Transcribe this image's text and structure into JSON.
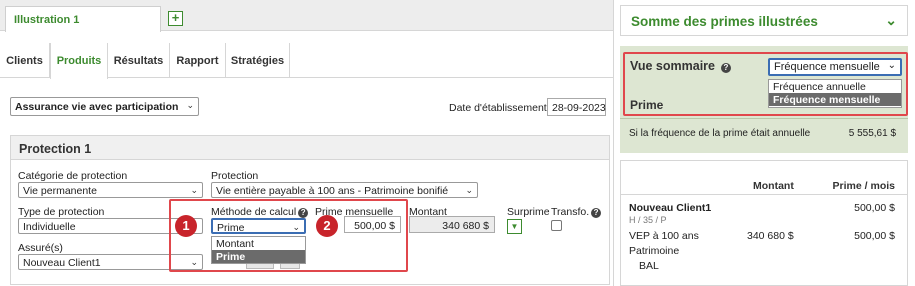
{
  "app": {
    "tab_title": "Illustration 1",
    "add_tab_label": "+"
  },
  "nav": {
    "tabs": [
      {
        "label": "Clients"
      },
      {
        "label": "Produits"
      },
      {
        "label": "Résultats"
      },
      {
        "label": "Rapport"
      },
      {
        "label": "Stratégies"
      }
    ],
    "active": "Produits"
  },
  "product": {
    "selected": "Assurance vie avec participation",
    "date_label": "Date d'établissement",
    "date_value": "28-09-2023"
  },
  "protection": {
    "title": "Protection 1",
    "category_label": "Catégorie de protection",
    "category_value": "Vie permanente",
    "protection_label": "Protection",
    "protection_value": "Vie entière payable à 100 ans - Patrimoine bonifié",
    "type_label": "Type de protection",
    "type_value": "Individuelle",
    "method_label": "Méthode de calcul",
    "method_value": "Prime",
    "method_options": [
      "Montant",
      "Prime"
    ],
    "premium_label": "Prime mensuelle",
    "premium_value": "500,00 $",
    "amount_label": "Montant",
    "amount_value": "340 680 $",
    "surprime_label": "Surprime",
    "transfo_label": "Transfo.",
    "insured_label": "Assuré(s)",
    "insured_value": "Nouveau Client1"
  },
  "badges": [
    "1",
    "2"
  ],
  "summary": {
    "title": "Somme des primes illustrées",
    "vue_title": "Vue sommaire",
    "frequency_selected": "Fréquence mensuelle",
    "frequency_options": [
      "Fréquence annuelle",
      "Fréquence mensuelle"
    ],
    "prime_label": "Prime",
    "annual_text": "Si la fréquence de la prime était annuelle",
    "annual_value": "5 555,61 $",
    "table_headers": {
      "montant": "Montant",
      "prime": "Prime / mois"
    },
    "client": {
      "name": "Nouveau Client1",
      "meta": "H / 35 / P",
      "prime": "500,00 $"
    },
    "coverage": {
      "name_line1": "VEP à 100 ans",
      "name_line2": "Patrimoine",
      "name_line3": "BAL",
      "montant": "340 680 $",
      "prime": "500,00 $"
    }
  },
  "colors": {
    "accent_green": "#3d8b2f",
    "highlight_red": "#e0474c",
    "badge_red": "#c8242b",
    "summary_green_bg": "#dde6d2",
    "select_blue": "#3b6db3"
  }
}
